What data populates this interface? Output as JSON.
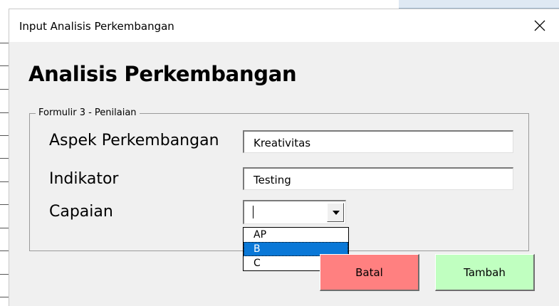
{
  "window": {
    "title": "Input Analisis Perkembangan"
  },
  "form": {
    "heading": "Analisis Perkembangan",
    "frame_caption": "Formulir 3 - Penilaian",
    "aspek": {
      "label": "Aspek Perkembangan",
      "value": "Kreativitas"
    },
    "indikator": {
      "label": "Indikator",
      "value": "Testing"
    },
    "capaian": {
      "label": "Capaian",
      "value": "",
      "options": [
        "AP",
        "B",
        "C"
      ],
      "highlighted": "B"
    }
  },
  "buttons": {
    "batal": "Batal",
    "tambah": "Tambah"
  },
  "colors": {
    "batal_bg": "#ff8080",
    "tambah_bg": "#c0ffc0",
    "highlight": "#0a78d7"
  },
  "icons": {
    "close": "close-icon",
    "dropdown": "chevron-down-icon"
  }
}
